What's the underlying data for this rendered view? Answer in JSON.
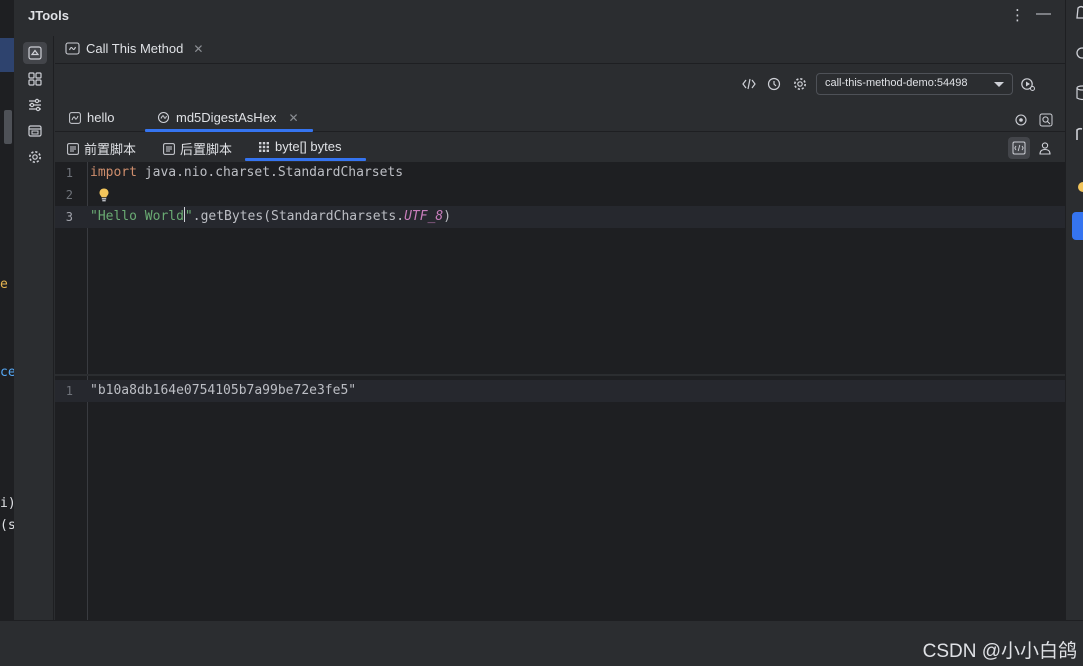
{
  "tool_window": {
    "title": "JTools",
    "more_icon": "more-vertical-icon",
    "minimize_icon": "minimize-icon"
  },
  "side_strip": [
    {
      "name": "strip-call-method",
      "icon": "call-method-icon"
    },
    {
      "name": "strip-grid",
      "icon": "grid-icon"
    },
    {
      "name": "strip-sliders",
      "icon": "sliders-icon"
    },
    {
      "name": "strip-window",
      "icon": "window-icon"
    },
    {
      "name": "strip-settings",
      "icon": "gear-icon"
    }
  ],
  "top_tab": {
    "label": "Call This Method"
  },
  "toolbar": {
    "process": "call-this-method-demo:54498"
  },
  "method_tabs": [
    {
      "label": "hello"
    },
    {
      "label": "md5DigestAsHex"
    }
  ],
  "sub_tabs": [
    {
      "label": "前置脚本"
    },
    {
      "label": "后置脚本"
    },
    {
      "label": "byte[] bytes"
    }
  ],
  "editor": {
    "lines": [
      {
        "num": "1",
        "kw": "import",
        "text": " java.nio.charset.StandardCharsets"
      },
      {
        "num": "2"
      },
      {
        "num": "3",
        "str_before_caret": "\"Hello World",
        "str_after_caret": "\"",
        "call": ".getBytes(StandardCharsets.",
        "const": "UTF_8",
        "close": ")"
      }
    ]
  },
  "result": {
    "lines": [
      {
        "num": "1",
        "text": "\"b10a8db164e0754105b7a99be72e3fe5\""
      }
    ]
  },
  "left_edge_fragments": [
    "e",
    "ce",
    "i)",
    "(s"
  ],
  "watermark": "CSDN @小小白鸽",
  "colors": {
    "accent": "#3574f0",
    "keyword": "#cf8e6d",
    "string": "#6aab73",
    "constant": "#c77dbb"
  }
}
